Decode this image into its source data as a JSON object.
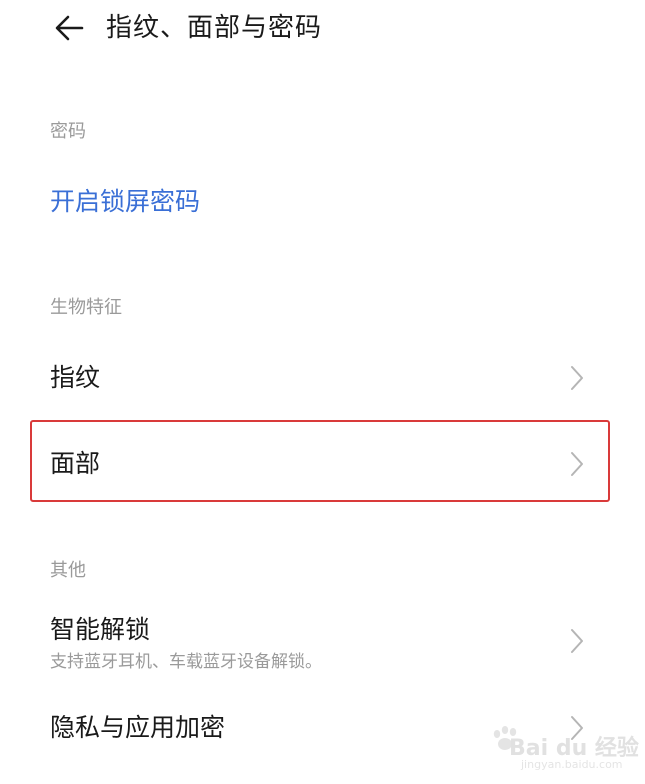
{
  "header": {
    "back_icon": "arrow-left-icon",
    "title": "指纹、面部与密码"
  },
  "sections": {
    "password": {
      "header": "密码",
      "link_label": "开启锁屏密码"
    },
    "biometrics": {
      "header": "生物特征",
      "items": [
        {
          "label": "指纹",
          "icon": "chevron-right-icon"
        },
        {
          "label": "面部",
          "icon": "chevron-right-icon",
          "highlighted": true
        }
      ]
    },
    "other": {
      "header": "其他",
      "items": [
        {
          "label": "智能解锁",
          "subtitle": "支持蓝牙耳机、车载蓝牙设备解锁。",
          "icon": "chevron-right-icon"
        },
        {
          "label": "隐私与应用加密",
          "icon": "chevron-right-icon"
        }
      ]
    }
  },
  "watermark": {
    "brand": "Bai du 经验",
    "site": "jingyan.baidu.com"
  },
  "colors": {
    "link": "#3a6fd6",
    "section_header": "#9a9a9a",
    "highlight": "#d93a3a",
    "text": "#1a1a1a",
    "chevron": "#b5b5b5"
  }
}
